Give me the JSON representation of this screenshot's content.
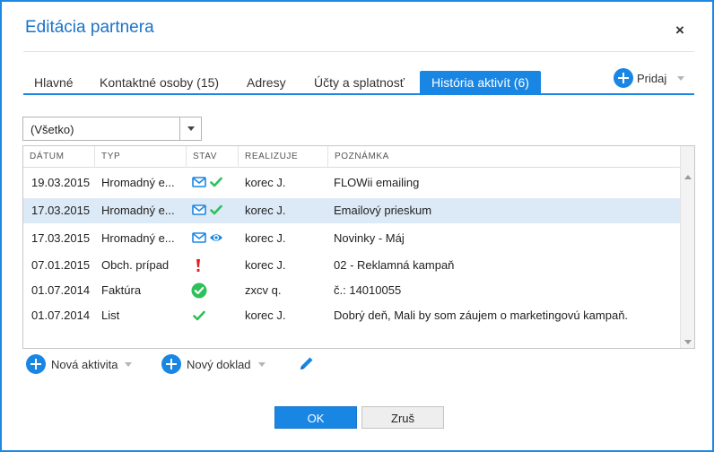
{
  "dialog": {
    "title": "Editácia partnera",
    "close_label": "×"
  },
  "tabs": [
    {
      "label": "Hlavné",
      "active": false
    },
    {
      "label": "Kontaktné osoby (15)",
      "active": false
    },
    {
      "label": "Adresy",
      "active": false
    },
    {
      "label": "Účty a splatnosť",
      "active": false
    },
    {
      "label": "História aktivít (6)",
      "active": true
    }
  ],
  "add_button": {
    "label": "Pridaj",
    "icon": "plus-circle-icon"
  },
  "filter": {
    "selected": "(Všetko)"
  },
  "grid": {
    "columns": [
      "DÁTUM",
      "TYP",
      "STAV",
      "REALIZUJE",
      "POZNÁMKA"
    ],
    "rows": [
      {
        "date": "19.03.2015",
        "type": "Hromadný e...",
        "status_icons": [
          "envelope-icon",
          "checkmark-icon"
        ],
        "by": "korec J.",
        "note": "FLOWii emailing",
        "selected": false
      },
      {
        "date": "17.03.2015",
        "type": "Hromadný e...",
        "status_icons": [
          "envelope-icon",
          "checkmark-icon"
        ],
        "by": "korec J.",
        "note": "Emailový prieskum",
        "selected": true
      },
      {
        "date": "17.03.2015",
        "type": "Hromadný e...",
        "status_icons": [
          "envelope-icon",
          "eye-icon"
        ],
        "by": "korec J.",
        "note": "Novinky - Máj",
        "selected": false
      },
      {
        "date": "07.01.2015",
        "type": "Obch. prípad",
        "status_icons": [
          "exclamation-icon"
        ],
        "by": "korec J.",
        "note": "02 - Reklamná kampaň",
        "selected": false
      },
      {
        "date": "01.07.2014",
        "type": "Faktúra",
        "status_icons": [
          "check-circle-icon"
        ],
        "by": "zxcv q.",
        "note": "č.: 14010055",
        "selected": false
      },
      {
        "date": "01.07.2014",
        "type": "List",
        "status_icons": [
          "checkmark-icon"
        ],
        "by": "korec J.",
        "note": "Dobrý deň, Mali by som záujem o marketingovú kampaň.",
        "selected": false
      }
    ]
  },
  "actions": {
    "new_activity": "Nová aktivita",
    "new_document": "Nový doklad",
    "edit_icon": "pencil-icon"
  },
  "footer": {
    "ok": "OK",
    "cancel": "Zruš"
  },
  "colors": {
    "accent": "#1a86e4",
    "title": "#1a73c8",
    "selected_row": "#dce9f6",
    "status_green": "#2ec05a",
    "status_red": "#e02020"
  }
}
